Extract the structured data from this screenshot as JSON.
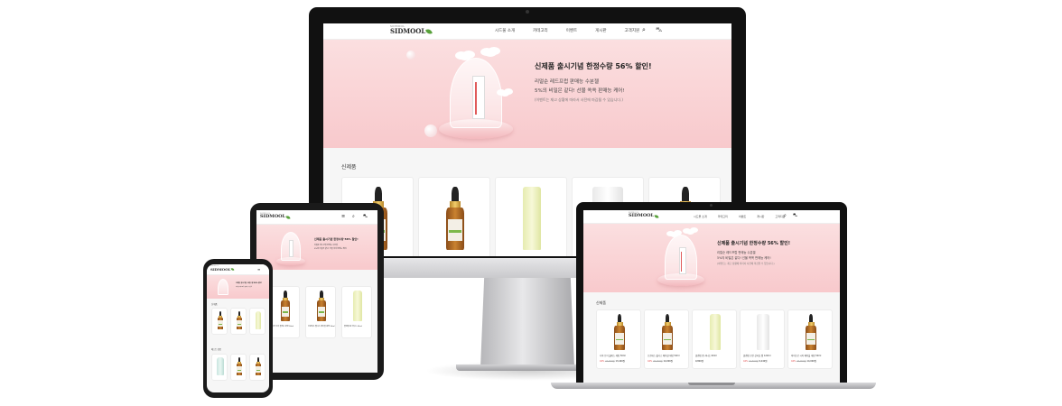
{
  "brand": {
    "tagline": "SIDMOOL",
    "logo_text": "SIDMOOL",
    "accent": "#f8c9cc",
    "leaf_color": "#58a03a",
    "sale_color": "#e04848"
  },
  "nav": {
    "items": [
      "시드물 소개",
      "카테고리",
      "이벤트",
      "게시판",
      "고객지원"
    ],
    "icons": [
      "search-icon",
      "cart-icon"
    ],
    "mobile_icons": [
      "menu-icon",
      "search-icon",
      "cart-icon"
    ]
  },
  "hero": {
    "title": "신제품 출시기념 한정수량 56% 할인!",
    "line1": "리얼순 레드프럽 판매능 수분젤",
    "line2": "5%의 비밀은 같다! 선물 쏙쏙 판매능 케어!",
    "note": "(이벤트는 재고 상황에 따라서 사전에 마감될 수 있습니다.)"
  },
  "products": {
    "section_title": "신제품",
    "section_title_2": "베스트 상품",
    "items": [
      {
        "name": "니아 브이 콜레스 세럼 50ml",
        "discount": "44%",
        "original": "24,000원",
        "sale": "13,440원",
        "kind": "dropper"
      },
      {
        "name": "프로테스 웰니스 페이셜 세럼 50ml",
        "discount": "44%",
        "original": "25,000원",
        "sale": "14,000원",
        "kind": "dropper"
      },
      {
        "name": "클렌징 폼 하나는 60ml",
        "discount": "",
        "original": "",
        "sale": "9,800원",
        "kind": "tube-yellow"
      },
      {
        "name": "클렌징 로션 살리실 젤 120ml",
        "discount": "44%",
        "original": "16,500원",
        "sale": "9,240원",
        "kind": "tube-white"
      },
      {
        "name": "아이프로 시어 베이블 세럼 50ml",
        "discount": "44%",
        "original": "25,000원",
        "sale": "14,000원",
        "kind": "dropper"
      }
    ]
  }
}
